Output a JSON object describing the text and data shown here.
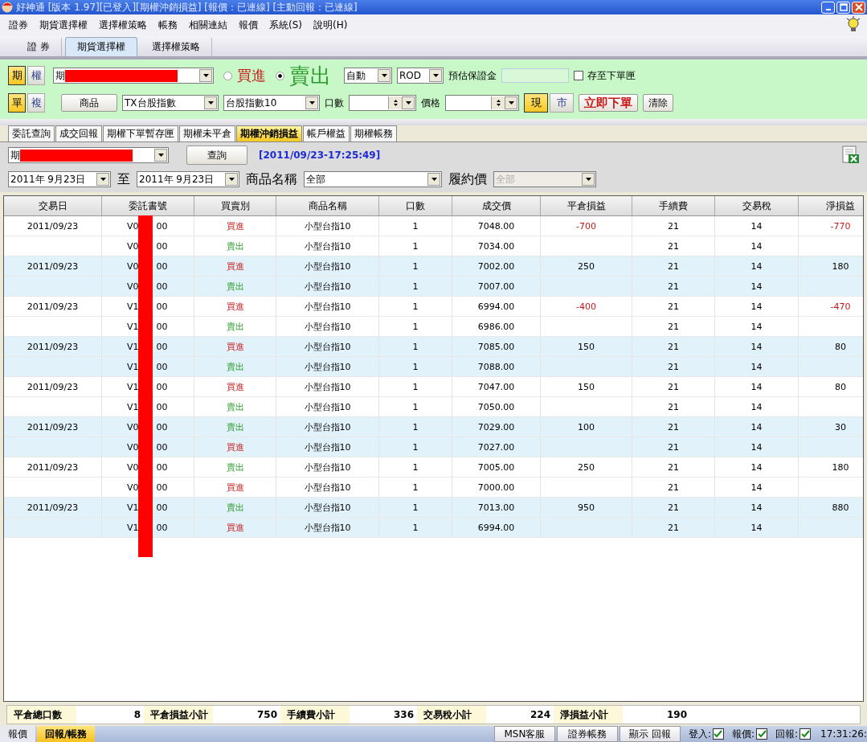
{
  "window": {
    "title": "好神通 [版本 1.97][已登入][期權沖銷損益] [報價：已連線] [主動回報：已連線]"
  },
  "menu": [
    "證券",
    "期貨選擇權",
    "選擇權策略",
    "帳務",
    "相關連結",
    "報價",
    "系統(S)",
    "說明(H)"
  ],
  "top_tabs": [
    {
      "label": "證 券",
      "selected": false
    },
    {
      "label": "期貨選擇權",
      "selected": true
    },
    {
      "label": "選擇權策略",
      "selected": false
    }
  ],
  "order_panel": {
    "market_toggle": [
      {
        "label": "期",
        "selected": true
      },
      {
        "label": "權",
        "selected": false
      }
    ],
    "account": {
      "prefix": "期"
    },
    "sides": [
      {
        "label": "買進",
        "kind": "buy",
        "selected": false
      },
      {
        "label": "賣出",
        "kind": "sell",
        "selected": true
      }
    ],
    "condition": "自動",
    "time_in_force": "ROD",
    "margin_label": "預估保證金",
    "save_checkbox": {
      "label": "存至下單匣",
      "checked": false
    },
    "mode_toggle": [
      {
        "label": "單",
        "selected": true
      },
      {
        "label": "複",
        "selected": false
      }
    ],
    "product_button": "商品",
    "product": "TX台股指數",
    "contract": "台股指數10",
    "qty_label": "口數",
    "price_label": "價格",
    "price_types": [
      {
        "label": "現",
        "selected": true
      },
      {
        "label": "市",
        "selected": false
      }
    ],
    "submit_button": "立即下單",
    "clear_button": "清除"
  },
  "sub_tabs": [
    {
      "label": "委託查詢",
      "selected": false
    },
    {
      "label": "成交回報",
      "selected": false
    },
    {
      "label": "期權下單暫存匣",
      "selected": false
    },
    {
      "label": "期權未平倉",
      "selected": false
    },
    {
      "label": "期權沖銷損益",
      "selected": true
    },
    {
      "label": "帳戶權益",
      "selected": false
    },
    {
      "label": "期權帳務",
      "selected": false
    }
  ],
  "filters": {
    "account": {
      "prefix": "期"
    },
    "query_button": "查詢",
    "timestamp": "[2011/09/23-17:25:49]",
    "date_from": "2011年  9月23日",
    "to_label": "至",
    "date_to": "2011年  9月23日",
    "product_label": "商品名稱",
    "product": "全部",
    "strike_label": "履約價",
    "strike": {
      "value": "全部",
      "disabled": true
    }
  },
  "table": {
    "columns": [
      "交易日",
      "委託書號",
      "買賣別",
      "商品名稱",
      "口數",
      "成交價",
      "平倉損益",
      "手續費",
      "交易稅",
      "淨損益"
    ],
    "rows": [
      {
        "date": "2011/09/23",
        "order_start": "V0",
        "order_end": "00",
        "side": "買進",
        "kind": "buy",
        "product": "小型台指10",
        "qty": "1",
        "price": "7048.00",
        "close_pl": "-700",
        "fee": "21",
        "tax": "14",
        "net": "-770",
        "loss": true
      },
      {
        "order_start": "V0",
        "order_end": "00",
        "side": "賣出",
        "kind": "sell",
        "product": "小型台指10",
        "qty": "1",
        "price": "7034.00",
        "fee": "21",
        "tax": "14"
      },
      {
        "date": "2011/09/23",
        "order_start": "V0",
        "order_end": "00",
        "side": "買進",
        "kind": "buy",
        "product": "小型台指10",
        "qty": "1",
        "price": "7002.00",
        "close_pl": "250",
        "fee": "21",
        "tax": "14",
        "net": "180",
        "loss": false
      },
      {
        "order_start": "V0",
        "order_end": "00",
        "side": "賣出",
        "kind": "sell",
        "product": "小型台指10",
        "qty": "1",
        "price": "7007.00",
        "fee": "21",
        "tax": "14"
      },
      {
        "date": "2011/09/23",
        "order_start": "V1",
        "order_end": "00",
        "side": "買進",
        "kind": "buy",
        "product": "小型台指10",
        "qty": "1",
        "price": "6994.00",
        "close_pl": "-400",
        "fee": "21",
        "tax": "14",
        "net": "-470",
        "loss": true
      },
      {
        "order_start": "V1",
        "order_end": "00",
        "side": "賣出",
        "kind": "sell",
        "product": "小型台指10",
        "qty": "1",
        "price": "6986.00",
        "fee": "21",
        "tax": "14"
      },
      {
        "date": "2011/09/23",
        "order_start": "V1",
        "order_end": "00",
        "side": "買進",
        "kind": "buy",
        "product": "小型台指10",
        "qty": "1",
        "price": "7085.00",
        "close_pl": "150",
        "fee": "21",
        "tax": "14",
        "net": "80",
        "loss": false
      },
      {
        "order_start": "V1",
        "order_end": "00",
        "side": "賣出",
        "kind": "sell",
        "product": "小型台指10",
        "qty": "1",
        "price": "7088.00",
        "fee": "21",
        "tax": "14"
      },
      {
        "date": "2011/09/23",
        "order_start": "V1",
        "order_end": "00",
        "side": "買進",
        "kind": "buy",
        "product": "小型台指10",
        "qty": "1",
        "price": "7047.00",
        "close_pl": "150",
        "fee": "21",
        "tax": "14",
        "net": "80",
        "loss": false
      },
      {
        "order_start": "V1",
        "order_end": "00",
        "side": "賣出",
        "kind": "sell",
        "product": "小型台指10",
        "qty": "1",
        "price": "7050.00",
        "fee": "21",
        "tax": "14"
      },
      {
        "date": "2011/09/23",
        "order_start": "V0",
        "order_end": "00",
        "side": "賣出",
        "kind": "sell",
        "product": "小型台指10",
        "qty": "1",
        "price": "7029.00",
        "close_pl": "100",
        "fee": "21",
        "tax": "14",
        "net": "30",
        "loss": false
      },
      {
        "order_start": "V0",
        "order_end": "00",
        "side": "買進",
        "kind": "buy",
        "product": "小型台指10",
        "qty": "1",
        "price": "7027.00",
        "fee": "21",
        "tax": "14"
      },
      {
        "date": "2011/09/23",
        "order_start": "V0",
        "order_end": "00",
        "side": "賣出",
        "kind": "sell",
        "product": "小型台指10",
        "qty": "1",
        "price": "7005.00",
        "close_pl": "250",
        "fee": "21",
        "tax": "14",
        "net": "180",
        "loss": false
      },
      {
        "order_start": "V0",
        "order_end": "00",
        "side": "買進",
        "kind": "buy",
        "product": "小型台指10",
        "qty": "1",
        "price": "7000.00",
        "fee": "21",
        "tax": "14"
      },
      {
        "date": "2011/09/23",
        "order_start": "V1",
        "order_end": "00",
        "side": "賣出",
        "kind": "sell",
        "product": "小型台指10",
        "qty": "1",
        "price": "7013.00",
        "close_pl": "950",
        "fee": "21",
        "tax": "14",
        "net": "880",
        "loss": false
      },
      {
        "order_start": "V1",
        "order_end": "00",
        "side": "買進",
        "kind": "buy",
        "product": "小型台指10",
        "qty": "1",
        "price": "6994.00",
        "fee": "21",
        "tax": "14"
      }
    ]
  },
  "summary": [
    {
      "label": "平倉總口數",
      "value": "8"
    },
    {
      "label": "平倉損益小計",
      "value": "750"
    },
    {
      "label": "手續費小計",
      "value": "336"
    },
    {
      "label": "交易稅小計",
      "value": "224"
    },
    {
      "label": "淨損益小計",
      "value": "190"
    }
  ],
  "status_bar": {
    "tabs": [
      {
        "label": "報價",
        "selected": false
      },
      {
        "label": "回報/帳務",
        "selected": true
      }
    ],
    "buttons": [
      "MSN客服",
      "證券帳務",
      "顯示 回報"
    ],
    "indicators": [
      {
        "label": "登入:",
        "checked": true
      },
      {
        "label": "報價:",
        "checked": true
      },
      {
        "label": "回報:",
        "checked": true
      }
    ],
    "clock": "17:31:26:"
  }
}
